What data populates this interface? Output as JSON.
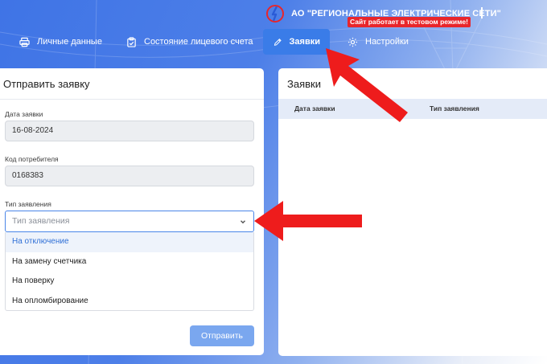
{
  "header": {
    "company": "АО \"РЕГИОНАЛЬНЫЕ ЭЛЕКТРИЧЕСКИЕ СЕТИ\"",
    "test_notice": "Сайт работает в тестовом режиме!"
  },
  "nav": {
    "items": [
      {
        "label": "Личные данные",
        "icon": "printer-icon"
      },
      {
        "label": "Состояние лицевого счета",
        "icon": "clipboard-icon"
      },
      {
        "label": "Заявки",
        "icon": "pencil-icon",
        "active": true
      },
      {
        "label": "Настройки",
        "icon": "gear-icon"
      }
    ]
  },
  "form": {
    "title": "Отправить заявку",
    "date_label": "Дата заявки",
    "date_value": "16-08-2024",
    "consumer_label": "Код потребителя",
    "consumer_value": "0168383",
    "type_label": "Тип заявления",
    "type_placeholder": "Тип заявления",
    "type_options": [
      "На отключение",
      "На замену счетчика",
      "На поверку",
      "На опломбирование"
    ],
    "highlighted_option": 0,
    "submit_label": "Отправить"
  },
  "requests": {
    "title": "Заявки",
    "columns": [
      "Дата заявки",
      "Тип заявления"
    ]
  },
  "colors": {
    "accent": "#3a7ce8",
    "annotation_arrow": "#ee1c1c",
    "badge": "#e8262b"
  }
}
